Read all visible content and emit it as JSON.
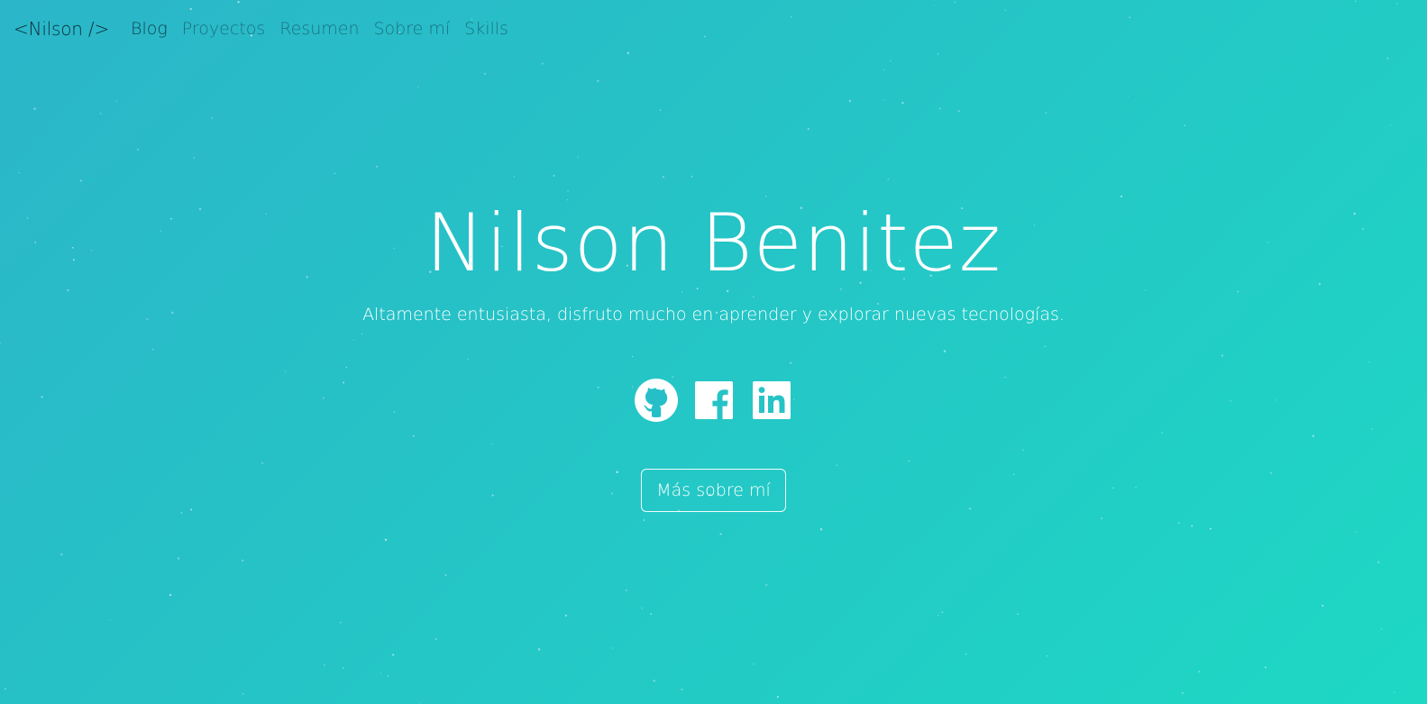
{
  "nav": {
    "brand": "<Nilson />",
    "links": [
      {
        "label": "Blog",
        "active": true
      },
      {
        "label": "Proyectos",
        "active": false
      },
      {
        "label": "Resumen",
        "active": false
      },
      {
        "label": "Sobre mí",
        "active": false
      },
      {
        "label": "Skills",
        "active": false
      }
    ]
  },
  "hero": {
    "title": "Nilson Benitez",
    "subtitle": "Altamente entusiasta, disfruto mucho en aprender y explorar nuevas tecnologías.",
    "social": [
      {
        "name": "github",
        "icon": "github-icon"
      },
      {
        "name": "facebook",
        "icon": "facebook-icon"
      },
      {
        "name": "linkedin",
        "icon": "linkedin-icon"
      }
    ],
    "cta_label": "Más sobre mí"
  },
  "colors": {
    "gradient_start": "#2bb6c9",
    "gradient_end": "#1ed8c4",
    "text": "#ffffff",
    "nav_active": "#114452",
    "nav_inactive": "rgba(16,70,86,0.62)"
  }
}
